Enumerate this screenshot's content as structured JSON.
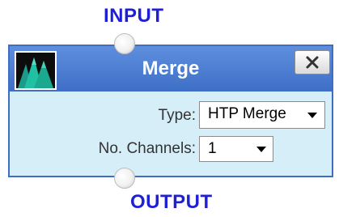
{
  "ports": {
    "input_label": "INPUT",
    "output_label": "OUTPUT"
  },
  "node": {
    "title": "Merge",
    "icon": "mountain-peaks-icon",
    "close_icon": "close-icon",
    "fields": {
      "type": {
        "label": "Type:",
        "value": "HTP Merge"
      },
      "channels": {
        "label": "No. Channels:",
        "value": "1"
      }
    }
  },
  "colors": {
    "header": "#4a7fd4",
    "panel": "#d6eef8",
    "port_label": "#1f1fd6",
    "icon_peaks": "#1fb89a"
  }
}
